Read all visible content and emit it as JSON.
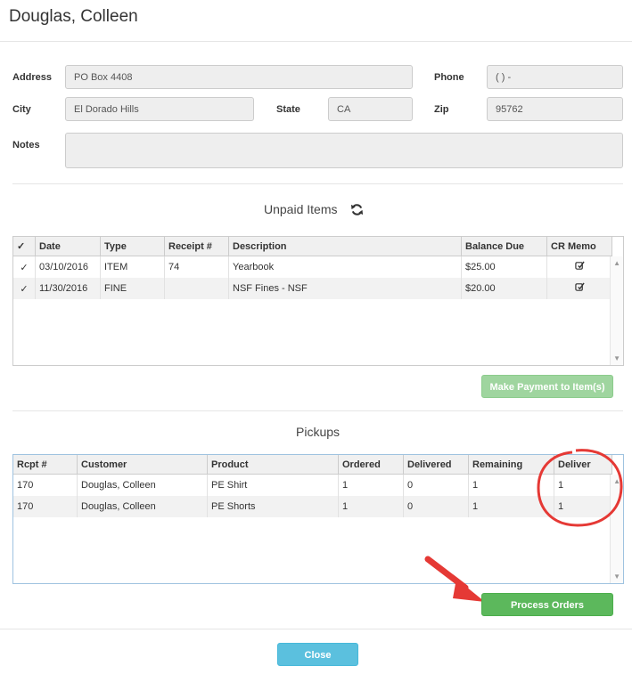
{
  "header": {
    "title": "Douglas, Colleen"
  },
  "form": {
    "address_label": "Address",
    "address_value": "PO Box 4408",
    "phone_label": "Phone",
    "phone_value": "( ) -",
    "city_label": "City",
    "city_value": "El Dorado Hills",
    "state_label": "State",
    "state_value": "CA",
    "zip_label": "Zip",
    "zip_value": "95762",
    "notes_label": "Notes",
    "notes_value": ""
  },
  "unpaid": {
    "title": "Unpaid Items",
    "columns": [
      "Date",
      "Type",
      "Receipt #",
      "Description",
      "Balance Due",
      "CR Memo"
    ],
    "rows": [
      {
        "date": "03/10/2016",
        "type": "ITEM",
        "receipt": "74",
        "description": "Yearbook",
        "balance": "$25.00"
      },
      {
        "date": "11/30/2016",
        "type": "FINE",
        "receipt": "",
        "description": "NSF Fines - NSF",
        "balance": "$20.00"
      }
    ],
    "pay_button": "Make Payment to Item(s)"
  },
  "pickups": {
    "title": "Pickups",
    "columns": [
      "Rcpt #",
      "Customer",
      "Product",
      "Ordered",
      "Delivered",
      "Remaining",
      "Deliver"
    ],
    "rows": [
      {
        "rcpt": "170",
        "customer": "Douglas, Colleen",
        "product": "PE Shirt",
        "ordered": "1",
        "delivered": "0",
        "remaining": "1",
        "deliver": "1"
      },
      {
        "rcpt": "170",
        "customer": "Douglas, Colleen",
        "product": "PE Shorts",
        "ordered": "1",
        "delivered": "0",
        "remaining": "1",
        "deliver": "1"
      }
    ],
    "process_button": "Process Orders"
  },
  "footer": {
    "close_button": "Close"
  },
  "colors": {
    "green": "#5cb85c",
    "green_light": "#9fd59f",
    "blue": "#5bc0de",
    "annotation_red": "#e53935"
  }
}
